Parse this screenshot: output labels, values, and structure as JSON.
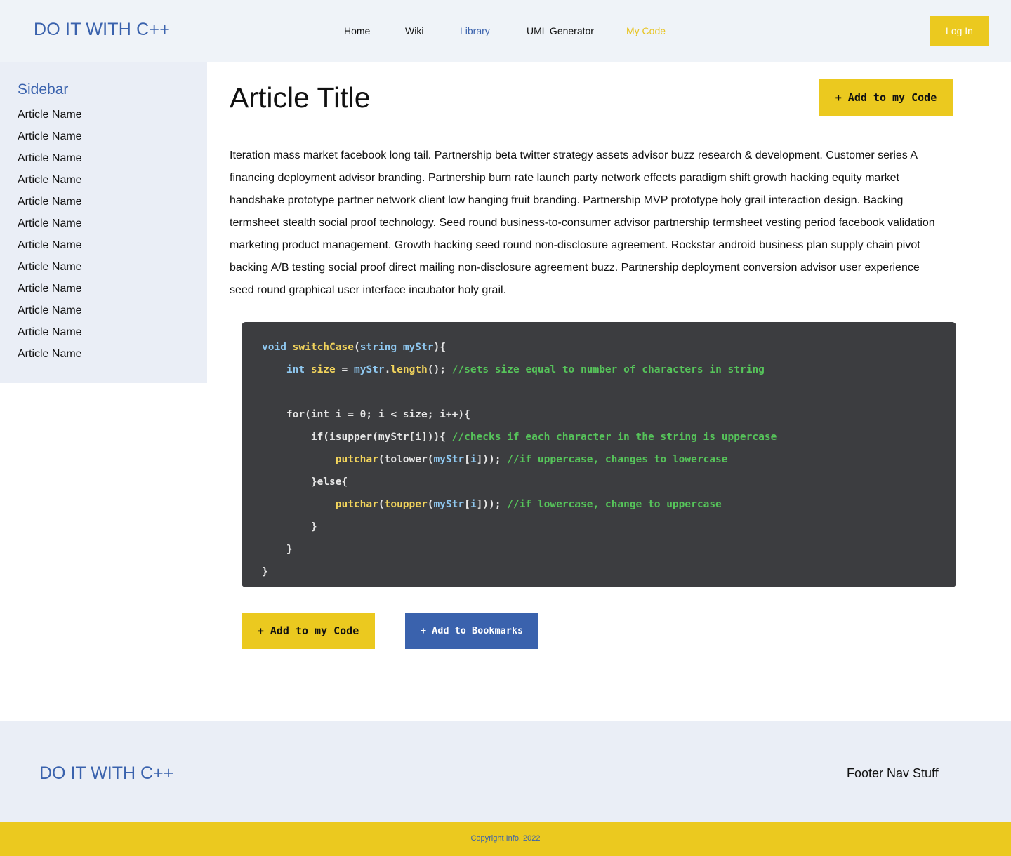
{
  "header": {
    "logo": "DO IT WITH C++",
    "nav": [
      "Home",
      "Wiki",
      "Library",
      "UML Generator",
      "My Code"
    ],
    "active_color": "#3a62ad",
    "highlight_color": "#e8c31e",
    "login_label": "Log In"
  },
  "sidebar": {
    "title": "Sidebar",
    "items": [
      "Article Name",
      "Article Name",
      "Article Name",
      "Article Name",
      "Article Name",
      "Article Name",
      "Article Name",
      "Article Name",
      "Article Name",
      "Article Name",
      "Article Name",
      "Article Name"
    ]
  },
  "article": {
    "title": "Article Title",
    "add_top_label": "+ Add to my Code",
    "body": "Iteration mass market facebook long tail. Partnership beta twitter strategy assets advisor buzz research & development. Customer series A financing deployment advisor branding. Partnership burn rate launch party network effects paradigm shift growth hacking equity market handshake prototype partner network client low hanging fruit branding. Partnership MVP prototype holy grail interaction design. Backing termsheet stealth social proof technology. Seed round business-to-consumer advisor partnership termsheet vesting period facebook validation marketing product management. Growth hacking seed round non-disclosure agreement. Rockstar android business plan supply chain pivot backing A/B testing social proof direct mailing non-disclosure agreement buzz. Partnership deployment conversion advisor user experience seed round graphical user interface incubator holy grail."
  },
  "code": {
    "lines": [
      [
        [
          "kw",
          "void"
        ],
        [
          "pl",
          " "
        ],
        [
          "fn",
          "switchCase"
        ],
        [
          "pl",
          "("
        ],
        [
          "kw",
          "string"
        ],
        [
          "pl",
          " "
        ],
        [
          "var",
          "myStr"
        ],
        [
          "pl",
          "){"
        ]
      ],
      [
        [
          "pl",
          "    "
        ],
        [
          "kw",
          "int"
        ],
        [
          "pl",
          " "
        ],
        [
          "fn",
          "size"
        ],
        [
          "pl",
          " = "
        ],
        [
          "var",
          "myStr"
        ],
        [
          "pl",
          "."
        ],
        [
          "fn",
          "length"
        ],
        [
          "pl",
          "(); "
        ],
        [
          "cm",
          "//sets size equal to number of characters in string"
        ]
      ],
      [
        [
          "pl",
          ""
        ]
      ],
      [
        [
          "pl",
          "    for(int i = 0; i < size; i++){"
        ]
      ],
      [
        [
          "pl",
          "        if(isupper(myStr[i])){ "
        ],
        [
          "cm",
          "//checks if each character in the string is uppercase"
        ]
      ],
      [
        [
          "pl",
          "            "
        ],
        [
          "fn",
          "putchar"
        ],
        [
          "pl",
          "(tolower("
        ],
        [
          "var",
          "myStr"
        ],
        [
          "pl",
          "["
        ],
        [
          "var",
          "i"
        ],
        [
          "pl",
          "])); "
        ],
        [
          "cm",
          "//if uppercase, changes to lowercase"
        ]
      ],
      [
        [
          "pl",
          "        }else{"
        ]
      ],
      [
        [
          "pl",
          "            "
        ],
        [
          "fn",
          "putchar"
        ],
        [
          "pl",
          "("
        ],
        [
          "fn",
          "toupper"
        ],
        [
          "pl",
          "("
        ],
        [
          "var",
          "myStr"
        ],
        [
          "pl",
          "["
        ],
        [
          "var",
          "i"
        ],
        [
          "pl",
          "])); "
        ],
        [
          "cm",
          "//if lowercase, change to uppercase"
        ]
      ],
      [
        [
          "pl",
          "        }"
        ]
      ],
      [
        [
          "pl",
          "    }"
        ]
      ],
      [
        [
          "pl",
          "}"
        ]
      ]
    ]
  },
  "actions": {
    "add_code_label": "+ Add to my Code",
    "add_bookmark_label": "+ Add to Bookmarks"
  },
  "footer": {
    "logo": "DO IT WITH C++",
    "nav": "Footer Nav Stuff",
    "copyright": "Copyright Info, 2022"
  },
  "colors": {
    "brand_blue": "#3a62ad",
    "brand_yellow": "#ebc91f",
    "code_bg": "#3c3d40"
  }
}
